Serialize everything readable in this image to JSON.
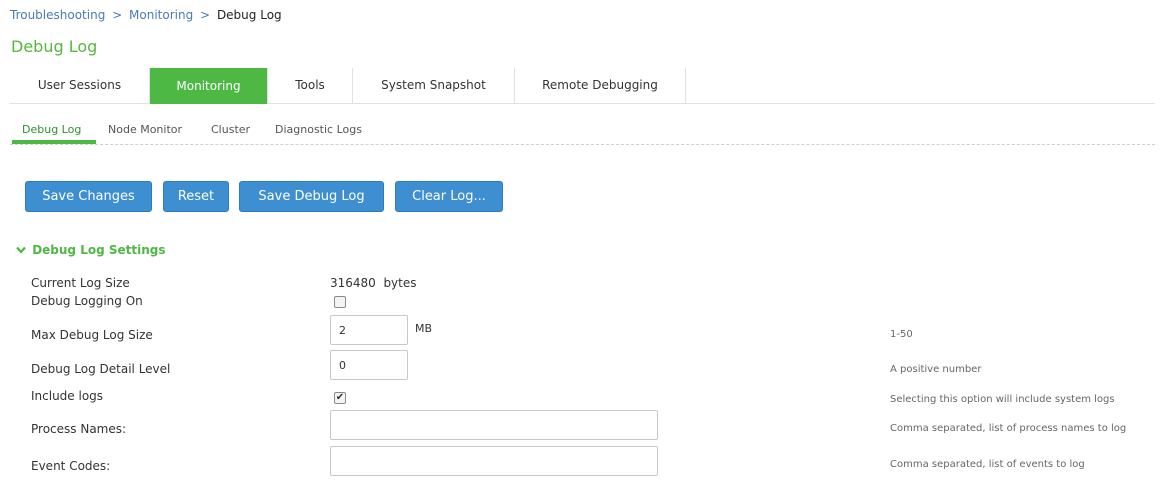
{
  "breadcrumb": {
    "item1": "Troubleshooting",
    "sep": ">",
    "item2": "Monitoring",
    "current": "Debug Log"
  },
  "page_title": "Debug Log",
  "top_tabs": [
    {
      "label": "User Sessions"
    },
    {
      "label": "Monitoring",
      "active": true
    },
    {
      "label": "Tools"
    },
    {
      "label": "System Snapshot"
    },
    {
      "label": "Remote Debugging"
    }
  ],
  "sub_tabs": [
    {
      "label": "Debug Log",
      "active": true
    },
    {
      "label": "Node Monitor"
    },
    {
      "label": "Cluster"
    },
    {
      "label": "Diagnostic Logs"
    }
  ],
  "buttons": {
    "save_changes": "Save Changes",
    "reset": "Reset",
    "save_debug_log": "Save Debug Log",
    "clear_log": "Clear Log..."
  },
  "section": {
    "title": "Debug Log Settings",
    "chevron": "✔"
  },
  "settings": {
    "current_log_size": {
      "label": "Current Log Size",
      "value": "316480  bytes"
    },
    "debug_logging_on": {
      "label": "Debug Logging On",
      "checked": false
    },
    "max_debug_log_size": {
      "label": "Max Debug Log Size",
      "value": "2",
      "unit": "MB",
      "hint": "1-50"
    },
    "detail_level": {
      "label": "Debug Log Detail Level",
      "value": "0",
      "hint": "A positive number"
    },
    "include_logs": {
      "label": "Include logs",
      "checked": true,
      "check_glyph": "✔",
      "hint": "Selecting this option will include system logs"
    },
    "process_names": {
      "label": "Process Names:",
      "value": "",
      "hint": "Comma separated, list of process names to log"
    },
    "event_codes": {
      "label": "Event Codes:",
      "value": "",
      "hint": "Comma separated, list of events to log"
    }
  },
  "colors": {
    "accent_green": "#4db844",
    "title_green": "#58b73f",
    "button_blue": "#3d8fd1",
    "link_blue": "#4a7ab8"
  }
}
